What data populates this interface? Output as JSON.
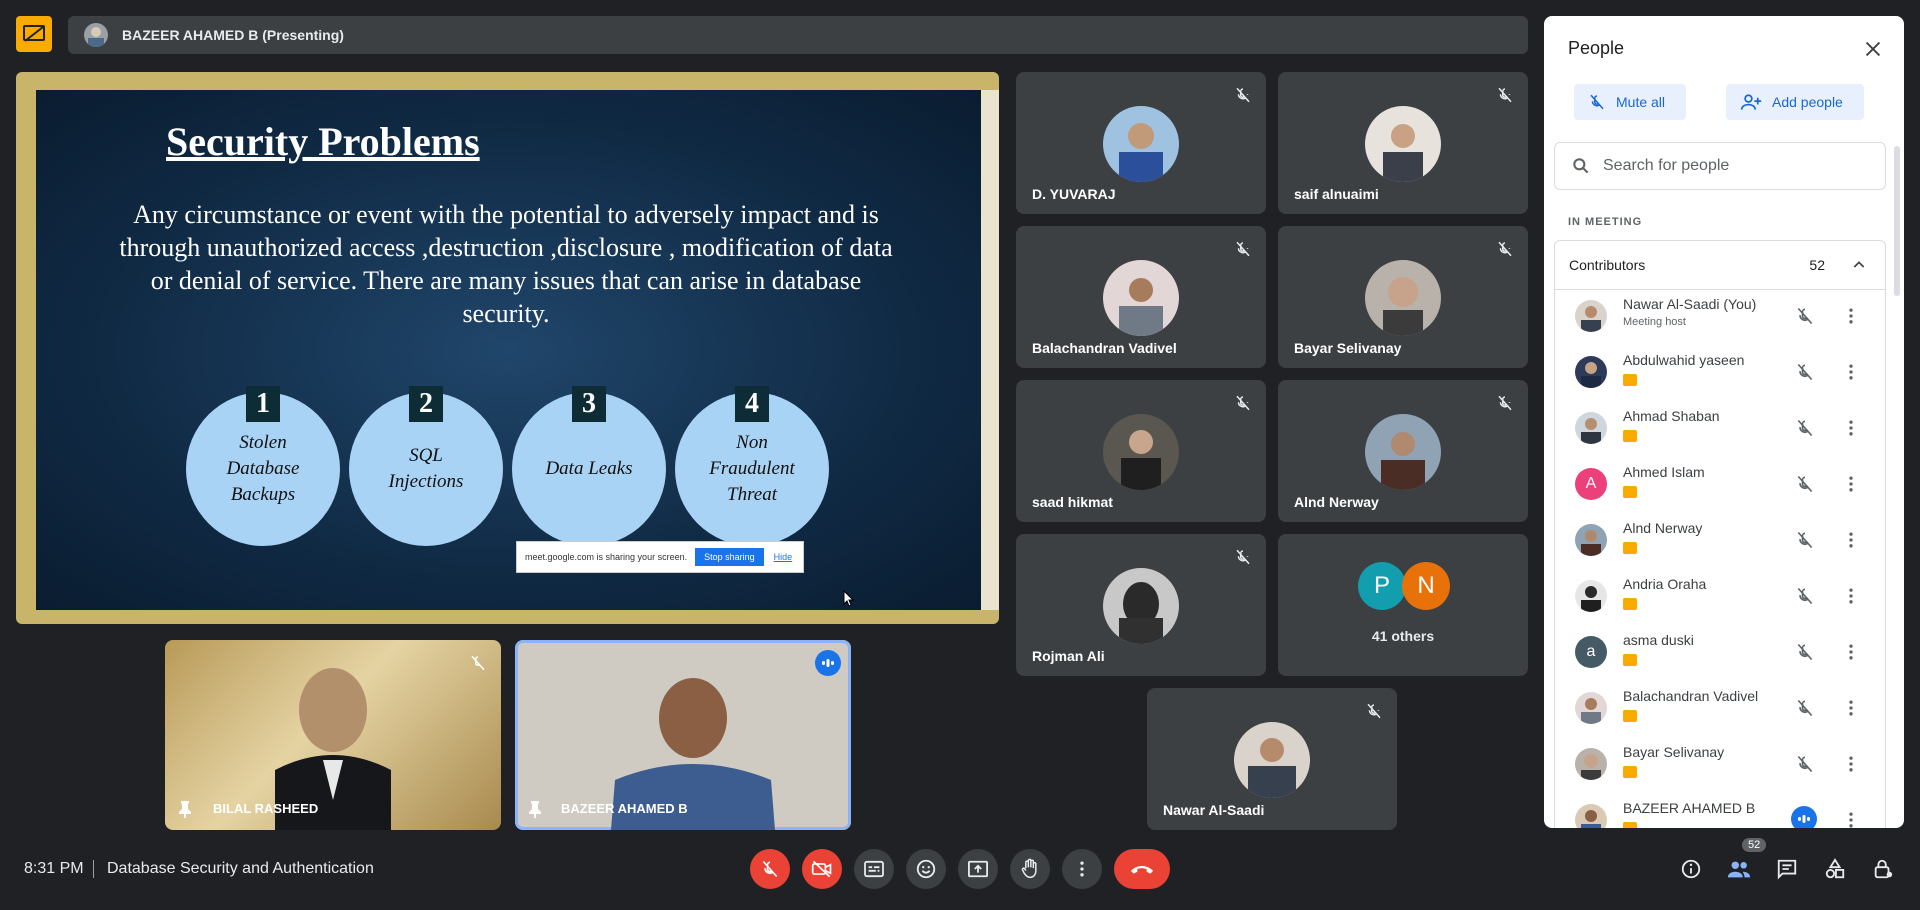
{
  "presenter_bar": {
    "text": "BAZEER AHAMED B (Presenting)"
  },
  "slide": {
    "title": "Security Problems",
    "body": "Any circumstance or event with the potential to adversely impact and is  through unauthorized access ,destruction ,disclosure , modification of data or denial of service. There are many issues that can arise in database security.",
    "items": [
      {
        "num": "1",
        "label": "Stolen Database Backups"
      },
      {
        "num": "2",
        "label": "SQL Injections"
      },
      {
        "num": "3",
        "label": "Data Leaks"
      },
      {
        "num": "4",
        "label": "Non Fraudulent Threat"
      }
    ],
    "share_banner": {
      "text": "meet.google.com is sharing your screen.",
      "stop": "Stop sharing",
      "hide": "Hide"
    }
  },
  "tiles": {
    "t1": "D. YUVARAJ",
    "t2": "saif alnuaimi",
    "t3": "Balachandran Vadivel",
    "t4": "Bayar Selivanay",
    "t5": "saad hikmat",
    "t6": "Alnd Nerway",
    "t7": "Rojman Ali",
    "others": "41 others",
    "others_p": "P",
    "others_n": "N",
    "t9": "Nawar Al-Saadi",
    "v1": "BILAL RASHEED",
    "v2": "BAZEER AHAMED B"
  },
  "people": {
    "title": "People",
    "mute_all": "Mute all",
    "add_people": "Add people",
    "search_placeholder": "Search for people",
    "in_meeting": "IN MEETING",
    "contributors": "Contributors",
    "count": "52",
    "list": [
      {
        "name": "Nawar Al-Saadi (You)",
        "sub": "Meeting host"
      },
      {
        "name": "Abdulwahid yaseen"
      },
      {
        "name": "Ahmad Shaban"
      },
      {
        "name": "Ahmed Islam",
        "initial": "A"
      },
      {
        "name": "Alnd Nerway"
      },
      {
        "name": "Andria Oraha"
      },
      {
        "name": "asma duski",
        "initial": "a"
      },
      {
        "name": "Balachandran Vadivel"
      },
      {
        "name": "Bayar Selivanay"
      },
      {
        "name": "BAZEER AHAMED B"
      }
    ]
  },
  "bottom": {
    "time": "8:31 PM",
    "meeting_name": "Database Security and Authentication",
    "people_count": "52"
  },
  "colors": {
    "accent": "#1a73e8",
    "danger": "#ea4335",
    "presenting": "#f9ab00",
    "bg": "#202124",
    "tile": "#3c4043"
  }
}
